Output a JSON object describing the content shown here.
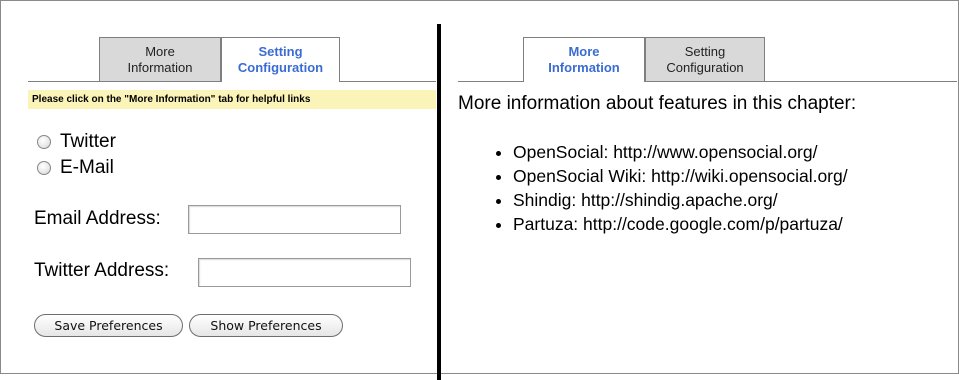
{
  "left_panel": {
    "tabs": [
      {
        "label_line1": "More",
        "label_line2": "Information",
        "state": "inactive"
      },
      {
        "label_line1": "Setting",
        "label_line2": "Configuration",
        "state": "active"
      }
    ],
    "notice": "Please click on the \"More Information\" tab for helpful links",
    "radio_options": [
      {
        "label": "Twitter",
        "selected": false
      },
      {
        "label": "E-Mail",
        "selected": false
      }
    ],
    "email_label": "Email Address:",
    "email_value": "",
    "twitter_label": "Twitter Address:",
    "twitter_value": "",
    "save_button": "Save Preferences",
    "show_button": "Show Preferences"
  },
  "right_panel": {
    "tabs": [
      {
        "label_line1": "More",
        "label_line2": "Information",
        "state": "active"
      },
      {
        "label_line1": "Setting",
        "label_line2": "Configuration",
        "state": "inactive"
      }
    ],
    "heading": "More information about features in this chapter:",
    "links": [
      "OpenSocial: http://www.opensocial.org/",
      "OpenSocial Wiki: http://wiki.opensocial.org/",
      "Shindig: http://shindig.apache.org/",
      "Partuza: http://code.google.com/p/partuza/"
    ]
  },
  "colors": {
    "active_tab_text": "#3a6cd4",
    "inactive_tab_bg": "#d9d9d9",
    "notice_bg": "#fbf4b8"
  }
}
